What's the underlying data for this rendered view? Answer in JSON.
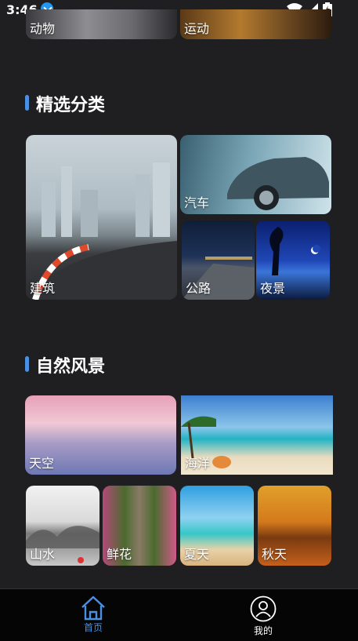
{
  "status_bar": {
    "time": "3:46"
  },
  "top_partial": {
    "items": [
      {
        "label": "动物"
      },
      {
        "label": "运动"
      }
    ]
  },
  "featured": {
    "title": "精选分类",
    "items": [
      {
        "label": "建筑"
      },
      {
        "label": "汽车"
      },
      {
        "label": "公路"
      },
      {
        "label": "夜景"
      }
    ]
  },
  "nature": {
    "title": "自然风景",
    "items": [
      {
        "label": "天空"
      },
      {
        "label": "海洋"
      },
      {
        "label": "山水"
      },
      {
        "label": "鲜花"
      },
      {
        "label": "夏天"
      },
      {
        "label": "秋天"
      }
    ]
  },
  "bottom_nav": {
    "items": [
      {
        "label": "首页",
        "icon": "home-icon",
        "active": true
      },
      {
        "label": "我的",
        "icon": "profile-icon",
        "active": false
      }
    ],
    "accent": "#4a90e2"
  }
}
